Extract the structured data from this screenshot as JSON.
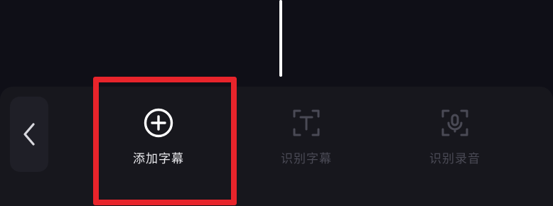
{
  "toolbar": {
    "back_icon": "chevron-left-icon",
    "tools": [
      {
        "label": "添加字幕",
        "icon": "plus-circle-icon",
        "state": "active"
      },
      {
        "label": "识别字幕",
        "icon": "text-scan-icon",
        "state": "disabled"
      },
      {
        "label": "识别录音",
        "icon": "voice-scan-icon",
        "state": "disabled"
      }
    ]
  },
  "colors": {
    "background": "#0f0f17",
    "toolbar": "#17171d",
    "highlight": "#e8242b",
    "active_text": "#e8e8ec",
    "disabled_text": "#4a4a55"
  }
}
